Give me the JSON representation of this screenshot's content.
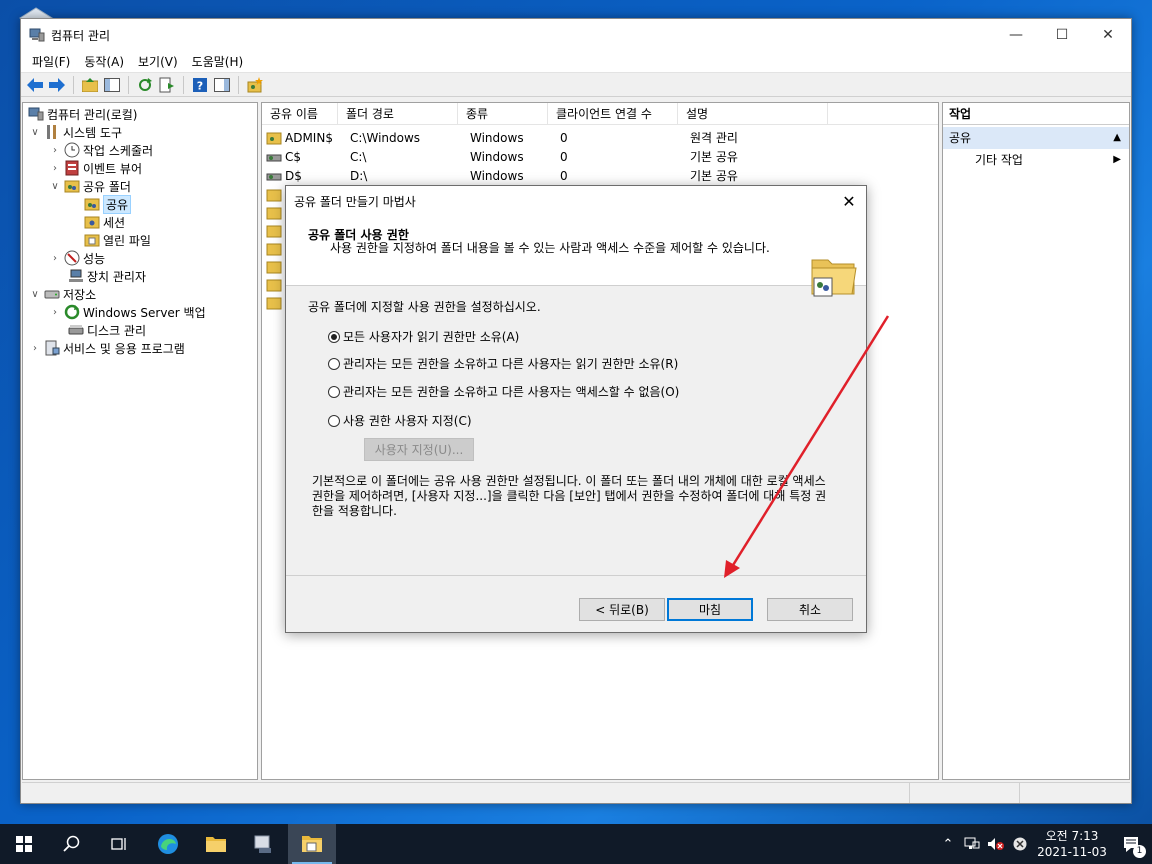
{
  "window": {
    "title": "컴퓨터 관리",
    "controls": [
      "—",
      "☐",
      "✕"
    ]
  },
  "menu": [
    "파일(F)",
    "동작(A)",
    "보기(V)",
    "도움말(H)"
  ],
  "tree": {
    "root": "컴퓨터 관리(로컬)",
    "system_tools": "시스템 도구",
    "task_scheduler": "작업 스케줄러",
    "event_viewer": "이벤트 뷰어",
    "shared_folders": "공유 폴더",
    "shares": "공유",
    "sessions": "세션",
    "open_files": "열린 파일",
    "performance": "성능",
    "device_manager": "장치 관리자",
    "storage": "저장소",
    "windows_backup": "Windows Server 백업",
    "disk_management": "디스크 관리",
    "services_apps": "서비스 및 응용 프로그램"
  },
  "list": {
    "columns": [
      "공유 이름",
      "폴더 경로",
      "종류",
      "클라이언트 연결 수",
      "설명"
    ],
    "rows": [
      {
        "name": "ADMIN$",
        "path": "C:\\Windows",
        "type": "Windows",
        "clients": "0",
        "desc": "원격 관리"
      },
      {
        "name": "C$",
        "path": "C:\\",
        "type": "Windows",
        "clients": "0",
        "desc": "기본 공유"
      },
      {
        "name": "D$",
        "path": "D:\\",
        "type": "Windows",
        "clients": "0",
        "desc": "기본 공유"
      }
    ]
  },
  "actions": {
    "header": "작업",
    "section": "공유",
    "more": "기타 작업"
  },
  "wizard": {
    "title": "공유 폴더 만들기 마법사",
    "header_title": "공유 폴더 사용 권한",
    "header_desc": "사용 권한을 지정하여 폴더 내용을 볼 수 있는 사람과 액세스 수준을 제어할 수 있습니다.",
    "prompt": "공유 폴더에 지정할 사용 권한을 설정하십시오.",
    "options": [
      "모든 사용자가 읽기 권한만 소유(A)",
      "관리자는 모든 권한을 소유하고 다른 사용자는 읽기 권한만 소유(R)",
      "관리자는 모든 권한을 소유하고 다른 사용자는 액세스할 수 없음(O)",
      "사용 권한 사용자 지정(C)"
    ],
    "selected_option": 0,
    "custom_button": "사용자 지정(U)...",
    "info": "기본적으로 이 폴더에는 공유 사용 권한만 설정됩니다. 이 폴더 또는 폴더 내의 개체에 대한 로컬 액세스 권한을 제어하려면, [사용자 지정...]을 클릭한 다음 [보안] 탭에서 권한을 수정하여 폴더에 대해 특정 권한을 적용합니다.",
    "back_button": "< 뒤로(B)",
    "finish_button": "마침",
    "cancel_button": "취소"
  },
  "taskbar": {
    "time": "오전 7:13",
    "date": "2021-11-03",
    "notification_count": "1"
  },
  "colors": {
    "accent": "#0078d7",
    "arrow": "#e0202a",
    "selection": "#cce8ff"
  }
}
